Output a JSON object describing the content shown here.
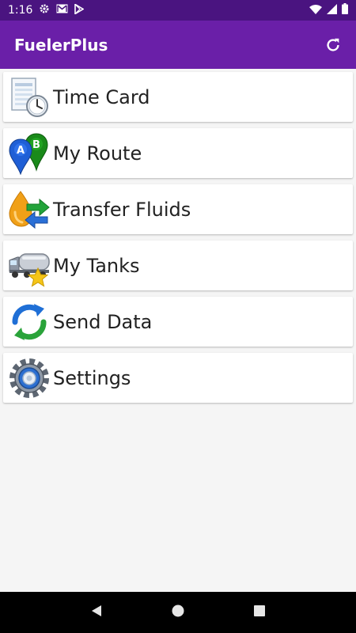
{
  "status_bar": {
    "time": "1:16",
    "icons": [
      "gear-icon",
      "gmail-icon",
      "play-store-icon",
      "wifi-icon",
      "signal-icon",
      "battery-icon"
    ]
  },
  "app_bar": {
    "title": "FuelerPlus",
    "action_icon": "refresh-icon",
    "colors": {
      "app_bar": "#6a1fa8",
      "status_bar": "#4a1480"
    }
  },
  "menu": {
    "items": [
      {
        "label": "Time Card",
        "icon": "time-card-icon"
      },
      {
        "label": "My Route",
        "icon": "route-pins-icon"
      },
      {
        "label": "Transfer Fluids",
        "icon": "transfer-fluids-icon"
      },
      {
        "label": "My Tanks",
        "icon": "tanker-truck-icon"
      },
      {
        "label": "Send Data",
        "icon": "sync-arrows-icon"
      },
      {
        "label": "Settings",
        "icon": "gear-settings-icon"
      }
    ]
  },
  "nav_bar": {
    "buttons": [
      "back-icon",
      "home-icon",
      "recents-icon"
    ]
  }
}
